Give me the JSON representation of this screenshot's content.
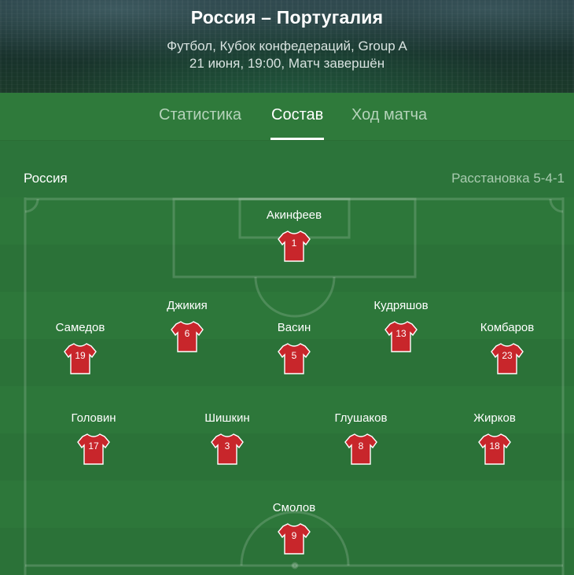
{
  "header": {
    "title": "Россия – Португалия",
    "competition": "Футбол, Кубок конфедераций, Group A",
    "datetime_status": "21 июня, 19:00, Матч завершён"
  },
  "tabs": [
    {
      "label": "Статистика",
      "active": false
    },
    {
      "label": "Состав",
      "active": true
    },
    {
      "label": "Ход матча",
      "active": false
    }
  ],
  "lineup": {
    "team": "Россия",
    "formation": "Расстановка 5-4-1",
    "shirt_color": "#c8262b",
    "players": [
      {
        "name": "Акинфеев",
        "number": "1"
      },
      {
        "name": "Джикия",
        "number": "6"
      },
      {
        "name": "Кудряшов",
        "number": "13"
      },
      {
        "name": "Самедов",
        "number": "19"
      },
      {
        "name": "Васин",
        "number": "5"
      },
      {
        "name": "Комбаров",
        "number": "23"
      },
      {
        "name": "Головин",
        "number": "17"
      },
      {
        "name": "Шишкин",
        "number": "3"
      },
      {
        "name": "Глушаков",
        "number": "8"
      },
      {
        "name": "Жирков",
        "number": "18"
      },
      {
        "name": "Смолов",
        "number": "9"
      }
    ]
  },
  "icons": {
    "shirt": "jersey-icon"
  }
}
